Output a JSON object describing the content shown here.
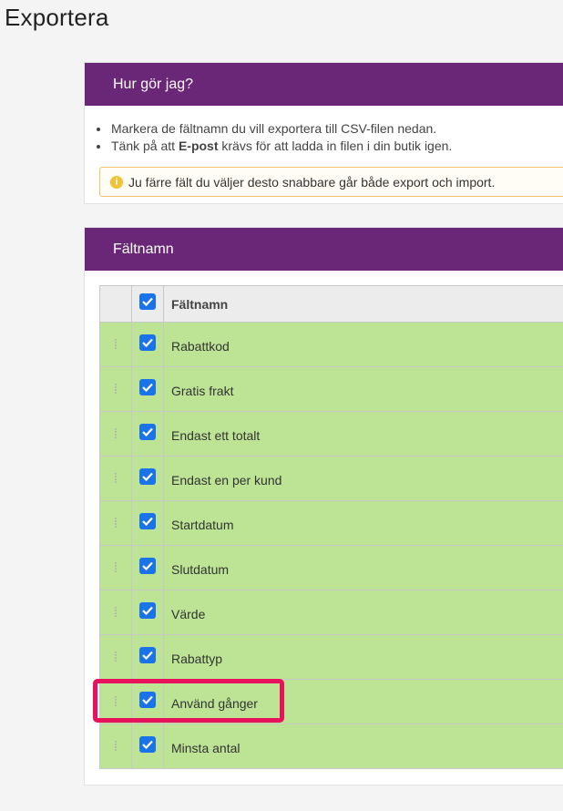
{
  "page": {
    "title": "Exportera"
  },
  "how_to": {
    "header": "Hur gör jag?",
    "bullets": [
      "Markera de fältnamn du vill exportera till CSV-filen nedan.",
      {
        "before": "Tänk på att ",
        "bold": "E-post",
        "after": " krävs för att ladda in filen i din butik igen."
      }
    ],
    "notice_icon": "info-icon",
    "notice": "Ju färre fält du väljer desto snabbare går både export och import."
  },
  "fields": {
    "header": "Fältnamn",
    "column_header": "Fältnamn",
    "select_all_checked": true,
    "rows": [
      {
        "label": "Rabattkod",
        "checked": true
      },
      {
        "label": "Gratis frakt",
        "checked": true
      },
      {
        "label": "Endast ett totalt",
        "checked": true
      },
      {
        "label": "Endast en per kund",
        "checked": true
      },
      {
        "label": "Startdatum",
        "checked": true
      },
      {
        "label": "Slutdatum",
        "checked": true
      },
      {
        "label": "Värde",
        "checked": true
      },
      {
        "label": "Rabattyp",
        "checked": true
      },
      {
        "label": "Använd gånger",
        "checked": true,
        "highlighted": true
      },
      {
        "label": "Minsta antal",
        "checked": true
      }
    ],
    "drag_handle_glyph": "⁞"
  },
  "colors": {
    "header_purple": "#6b2777",
    "row_green": "#bde495",
    "checkbox_blue": "#1a73e8",
    "highlight_pink": "#e8125c",
    "notice_border": "#f0c36d"
  }
}
